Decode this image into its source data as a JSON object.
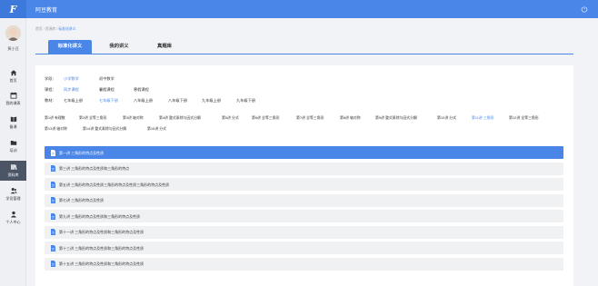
{
  "app": {
    "logo": "F",
    "title": "阿豆教育"
  },
  "user": {
    "name": "黄小豆"
  },
  "nav": [
    {
      "label": "首页",
      "icon": "home-icon"
    },
    {
      "label": "我的课表",
      "icon": "calendar-icon"
    },
    {
      "label": "备课",
      "icon": "book-icon"
    },
    {
      "label": "培训",
      "icon": "folder-icon"
    },
    {
      "label": "资料库",
      "icon": "library-icon"
    },
    {
      "label": "学员管理",
      "icon": "students-icon"
    },
    {
      "label": "个人中心",
      "icon": "person-icon"
    }
  ],
  "breadcrumb": {
    "first": "首页",
    "sep1": "/",
    "second": "资源库",
    "sep2": "/",
    "current": "标准化讲义"
  },
  "tabs": [
    "标准化讲义",
    "我的讲义",
    "真题库"
  ],
  "filters": {
    "stage": {
      "label": "学段：",
      "options": [
        "小学数学",
        "初中数学"
      ],
      "selected": 0
    },
    "course": {
      "label": "课程：",
      "options": [
        "同步课程",
        "暑假课程",
        "寒假课程"
      ],
      "selected": 0
    },
    "book": {
      "label": "教材：",
      "options": [
        "七年级上册",
        "七年级下册",
        "八年级上册",
        "八年级下册",
        "九年级上册",
        "九年级下册"
      ],
      "selected": 1
    }
  },
  "lesson_tabs": [
    "第1讲 有理数",
    "第2讲 全等三角形",
    "第3讲 轴对称",
    "第4讲 整式乘除与因式分解",
    "第5讲 分式",
    "第6讲 全等三角形",
    "第7讲 全等三角形",
    "第8讲 轴对称",
    "第9讲 整式乘除与因式分解",
    "第10讲 分式",
    "第11讲 三角形",
    "第12讲 全等三角形",
    "第13讲 轴对称",
    "第14讲 整式乘除与因式分解",
    "第15讲 分式"
  ],
  "lesson_selected": 10,
  "lessons": [
    "第一讲  三角形的特点及性质",
    "第三讲  三角形的特点及性质和三角形的特点",
    "第五讲  三角形的特点及性质三角形的特点及性质三角形的特点及性质",
    "第七讲  三角形的特点及性质",
    "第九讲  三角形的特点及性质和三角形的特点及性质",
    "第十一讲  三角形的特点及性质和三角形的特点及性质",
    "第十三讲  三角形的特点及性质和三角形的特点及性质",
    "第十五讲  三角形的特点及性质和三角形的特点及性质"
  ],
  "lesson_active": 0,
  "colors": {
    "accent": "#4a86e8",
    "sidebar_active": "#4b5566"
  }
}
